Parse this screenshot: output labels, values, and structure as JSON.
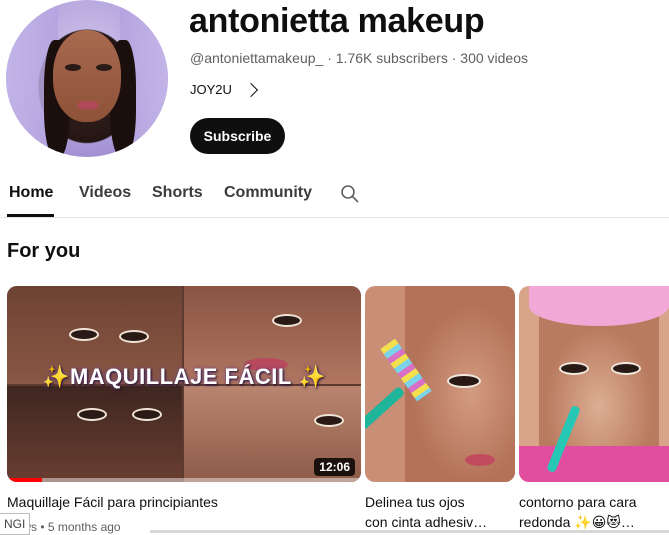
{
  "channel": {
    "name": "antonietta makeup",
    "handle": "@antoniettamakeup_",
    "sep1": "·",
    "subscribers": "1.76K subscribers",
    "sep2": "·",
    "videos": "300 videos",
    "link_label": "JOY2U",
    "subscribe_label": "Subscribe"
  },
  "tabs": [
    {
      "label": "Home",
      "active": true
    },
    {
      "label": "Videos",
      "active": false
    },
    {
      "label": "Shorts",
      "active": false
    },
    {
      "label": "Community",
      "active": false
    }
  ],
  "section_title": "For you",
  "videos": [
    {
      "thumb_text": "✨MAQUILLAJE FÁCIL ✨",
      "duration": "12:06",
      "progress": 0.1,
      "title": "Maquillaje Fácil para principiantes",
      "meta": "views • 5 months ago"
    },
    {
      "title_line1": "Delinea tus ojos",
      "title_line2": "con cinta adhesiv…"
    },
    {
      "title_line1": "contorno para cara",
      "title_line2": "redonda ✨😀😻…"
    }
  ],
  "corner_chip": "NGI",
  "colors": {
    "subscribe_bg": "#0f0f0f",
    "progress": "#ff0000",
    "text_primary": "#0f0f0f",
    "text_secondary": "#606060"
  },
  "icons": [
    "search-icon",
    "chevron-right-icon"
  ]
}
